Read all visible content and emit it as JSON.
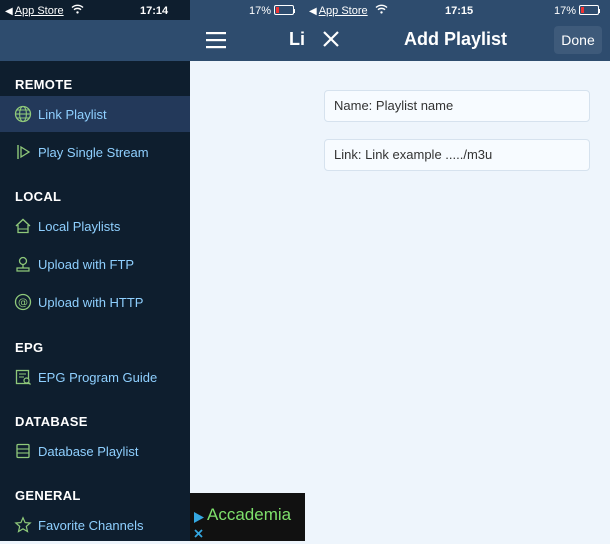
{
  "status_left": {
    "back_app": "App Store",
    "time": "17:14"
  },
  "status_middle": {
    "battery": "17%",
    "back_app": "App Store",
    "time": "17:15"
  },
  "status_right": {
    "battery": "17%"
  },
  "header_left": {
    "title_partial": "Li"
  },
  "header_right": {
    "title": "Add Playlist",
    "done_label": "Done"
  },
  "sidebar": {
    "sections": [
      {
        "title": "REMOTE",
        "items": [
          {
            "label": "Link Playlist",
            "icon": "globe-icon"
          },
          {
            "label": "Play Single Stream",
            "icon": "play-stream-icon"
          }
        ]
      },
      {
        "title": "LOCAL",
        "items": [
          {
            "label": "Local Playlists",
            "icon": "home-icon"
          },
          {
            "label": "Upload with FTP",
            "icon": "ftp-upload-icon"
          },
          {
            "label": "Upload with HTTP",
            "icon": "http-at-icon"
          }
        ]
      },
      {
        "title": "EPG",
        "items": [
          {
            "label": "EPG Program Guide",
            "icon": "epg-guide-icon"
          }
        ]
      },
      {
        "title": "DATABASE",
        "items": [
          {
            "label": "Database Playlist",
            "icon": "database-icon"
          }
        ]
      },
      {
        "title": "GENERAL",
        "items": [
          {
            "label": "Favorite Channels",
            "icon": "star-icon"
          }
        ]
      }
    ]
  },
  "form": {
    "name_value": "Name: Playlist name",
    "link_value": "Link: Link example ...../m3u"
  },
  "ad": {
    "text": "Accademia"
  },
  "colors": {
    "sidebar_bg": "#0e1e2e",
    "header_bg": "#2e4c6e",
    "accent": "#8fd0ff",
    "body_bg": "#eef5fc"
  }
}
